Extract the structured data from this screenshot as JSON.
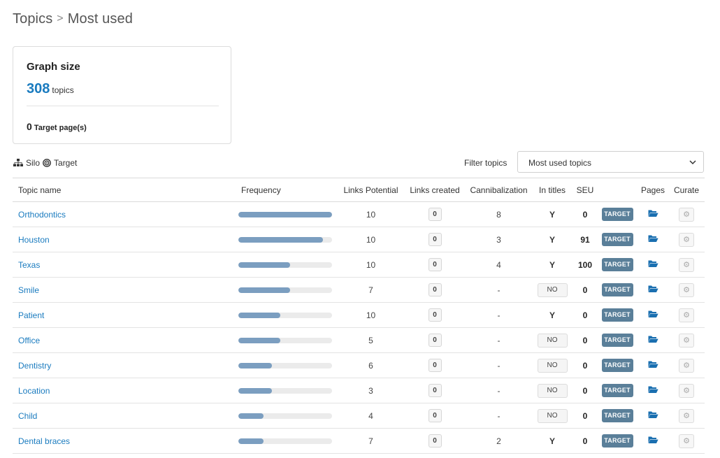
{
  "breadcrumb": {
    "root": "Topics",
    "separator": ">",
    "current": "Most used"
  },
  "card": {
    "title": "Graph size",
    "topic_count": "308",
    "topic_unit": "topics",
    "target_count": "0",
    "target_label": "Target page(s)"
  },
  "legend": {
    "silo": "Silo",
    "target": "Target"
  },
  "filter": {
    "label": "Filter topics",
    "selected": "Most used topics"
  },
  "columns": {
    "topic_name": "Topic name",
    "frequency": "Frequency",
    "links_potential": "Links Potential",
    "links_created": "Links created",
    "cannibalization": "Cannibalization",
    "in_titles": "In titles",
    "seu": "SEU",
    "target": "",
    "pages": "Pages",
    "curate": "Curate"
  },
  "rows": [
    {
      "name": "Orthodontics",
      "frequency": 1.0,
      "links_potential": "10",
      "links_created": "0",
      "cannibalization": "8",
      "in_titles": "Y",
      "seu": "0",
      "target": "TARGET"
    },
    {
      "name": "Houston",
      "frequency": 0.9,
      "links_potential": "10",
      "links_created": "0",
      "cannibalization": "3",
      "in_titles": "Y",
      "seu": "91",
      "target": "TARGET"
    },
    {
      "name": "Texas",
      "frequency": 0.55,
      "links_potential": "10",
      "links_created": "0",
      "cannibalization": "4",
      "in_titles": "Y",
      "seu": "100",
      "target": "TARGET"
    },
    {
      "name": "Smile",
      "frequency": 0.55,
      "links_potential": "7",
      "links_created": "0",
      "cannibalization": "-",
      "in_titles": "NO",
      "seu": "0",
      "target": "TARGET"
    },
    {
      "name": "Patient",
      "frequency": 0.45,
      "links_potential": "10",
      "links_created": "0",
      "cannibalization": "-",
      "in_titles": "Y",
      "seu": "0",
      "target": "TARGET"
    },
    {
      "name": "Office",
      "frequency": 0.45,
      "links_potential": "5",
      "links_created": "0",
      "cannibalization": "-",
      "in_titles": "NO",
      "seu": "0",
      "target": "TARGET"
    },
    {
      "name": "Dentistry",
      "frequency": 0.36,
      "links_potential": "6",
      "links_created": "0",
      "cannibalization": "-",
      "in_titles": "NO",
      "seu": "0",
      "target": "TARGET"
    },
    {
      "name": "Location",
      "frequency": 0.36,
      "links_potential": "3",
      "links_created": "0",
      "cannibalization": "-",
      "in_titles": "NO",
      "seu": "0",
      "target": "TARGET"
    },
    {
      "name": "Child",
      "frequency": 0.27,
      "links_potential": "4",
      "links_created": "0",
      "cannibalization": "-",
      "in_titles": "NO",
      "seu": "0",
      "target": "TARGET"
    },
    {
      "name": "Dental braces",
      "frequency": 0.27,
      "links_potential": "7",
      "links_created": "0",
      "cannibalization": "2",
      "in_titles": "Y",
      "seu": "0",
      "target": "TARGET"
    }
  ],
  "icons": {
    "folder": "folder-open-icon",
    "curate": "gear-icon",
    "silo": "sitemap-icon",
    "target": "bullseye-icon",
    "dropdown": "chevron-down-icon"
  },
  "colors": {
    "link": "#1a7bbf",
    "bar_fill": "#7b9ec0",
    "target_button": "#5a7f99",
    "folder": "#1a6fb0"
  }
}
